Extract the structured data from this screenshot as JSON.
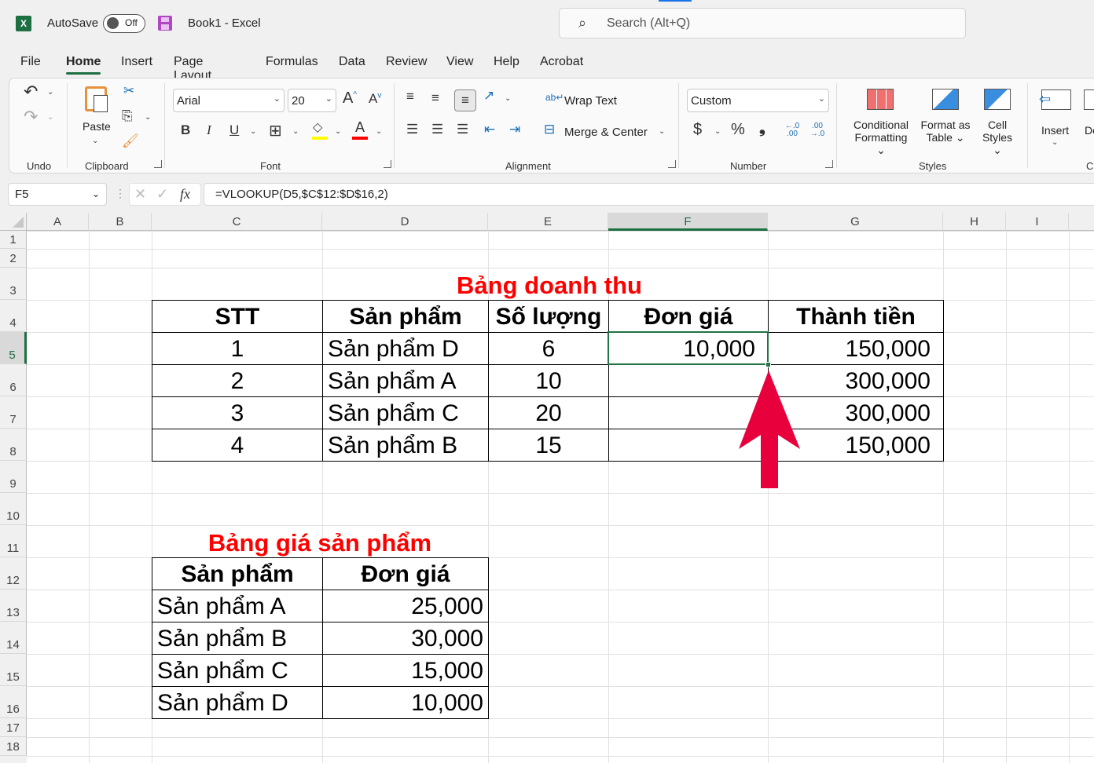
{
  "titlebar": {
    "app_icon": "excel-icon",
    "autosave_label": "AutoSave",
    "autosave_state": "Off",
    "doc_title": "Book1  -  Excel",
    "search_placeholder": "Search (Alt+Q)"
  },
  "tabs": [
    "File",
    "Home",
    "Insert",
    "Page Layout",
    "Formulas",
    "Data",
    "Review",
    "View",
    "Help",
    "Acrobat"
  ],
  "active_tab": "Home",
  "ribbon": {
    "undo": {
      "group_label": "Undo"
    },
    "clipboard": {
      "paste_label": "Paste",
      "group_label": "Clipboard"
    },
    "font": {
      "font_name": "Arial",
      "font_size": "20",
      "group_label": "Font",
      "bold": "B",
      "italic": "I",
      "underline": "U",
      "grow": "A",
      "shrink": "A",
      "font_color_glyph": "A",
      "highlight_color": "#ffff00",
      "font_color": "#ff0000"
    },
    "alignment": {
      "wrap_text": "Wrap Text",
      "merge_center": "Merge & Center",
      "group_label": "Alignment"
    },
    "number": {
      "format": "Custom",
      "currency": "$",
      "percent": "%",
      "comma": "❟",
      "inc_decimal": "←.0 .00",
      "dec_decimal": ".00 →.0",
      "group_label": "Number"
    },
    "styles": {
      "conditional_formatting": [
        "Conditional",
        "Formatting"
      ],
      "format_as_table": [
        "Format as",
        "Table"
      ],
      "cell_styles": [
        "Cell",
        "Styles"
      ],
      "group_label": "Styles"
    },
    "cells": {
      "insert": "Insert",
      "delete_partial": "De",
      "group_label_partial": "C"
    }
  },
  "formula_bar": {
    "name_box": "F5",
    "cancel": "✕",
    "enter": "✓",
    "fx": "fx",
    "formula": "=VLOOKUP(D5,$C$12:$D$16,2)"
  },
  "columns": [
    "A",
    "B",
    "C",
    "D",
    "E",
    "F",
    "G",
    "H",
    "I"
  ],
  "selected_column": "F",
  "rows": [
    "1",
    "2",
    "3",
    "4",
    "5",
    "6",
    "7",
    "8",
    "9",
    "10",
    "11",
    "12",
    "13",
    "14",
    "15",
    "16",
    "17",
    "18"
  ],
  "selected_row": "5",
  "sales_table": {
    "title": "Bảng doanh thu",
    "headers": [
      "STT",
      "Sản phẩm",
      "Số lượng",
      "Đơn giá",
      "Thành tiền"
    ],
    "rows": [
      [
        "1",
        "Sản phẩm D",
        "6",
        "10,000",
        "150,000"
      ],
      [
        "2",
        "Sản phẩm A",
        "10",
        "",
        "300,000"
      ],
      [
        "3",
        "Sản phẩm C",
        "20",
        "",
        "300,000"
      ],
      [
        "4",
        "Sản phẩm B",
        "15",
        "",
        "150,000"
      ]
    ]
  },
  "price_table": {
    "title": "Bảng giá sản phẩm",
    "headers": [
      "Sản phẩm",
      "Đơn giá"
    ],
    "rows": [
      [
        "Sản phẩm A",
        "25,000"
      ],
      [
        "Sản phẩm B",
        "30,000"
      ],
      [
        "Sản phẩm C",
        "15,000"
      ],
      [
        "Sản phẩm D",
        "10,000"
      ]
    ]
  },
  "annotation": {
    "arrow_color": "#e8003d",
    "points_to": "F5 fill handle"
  }
}
